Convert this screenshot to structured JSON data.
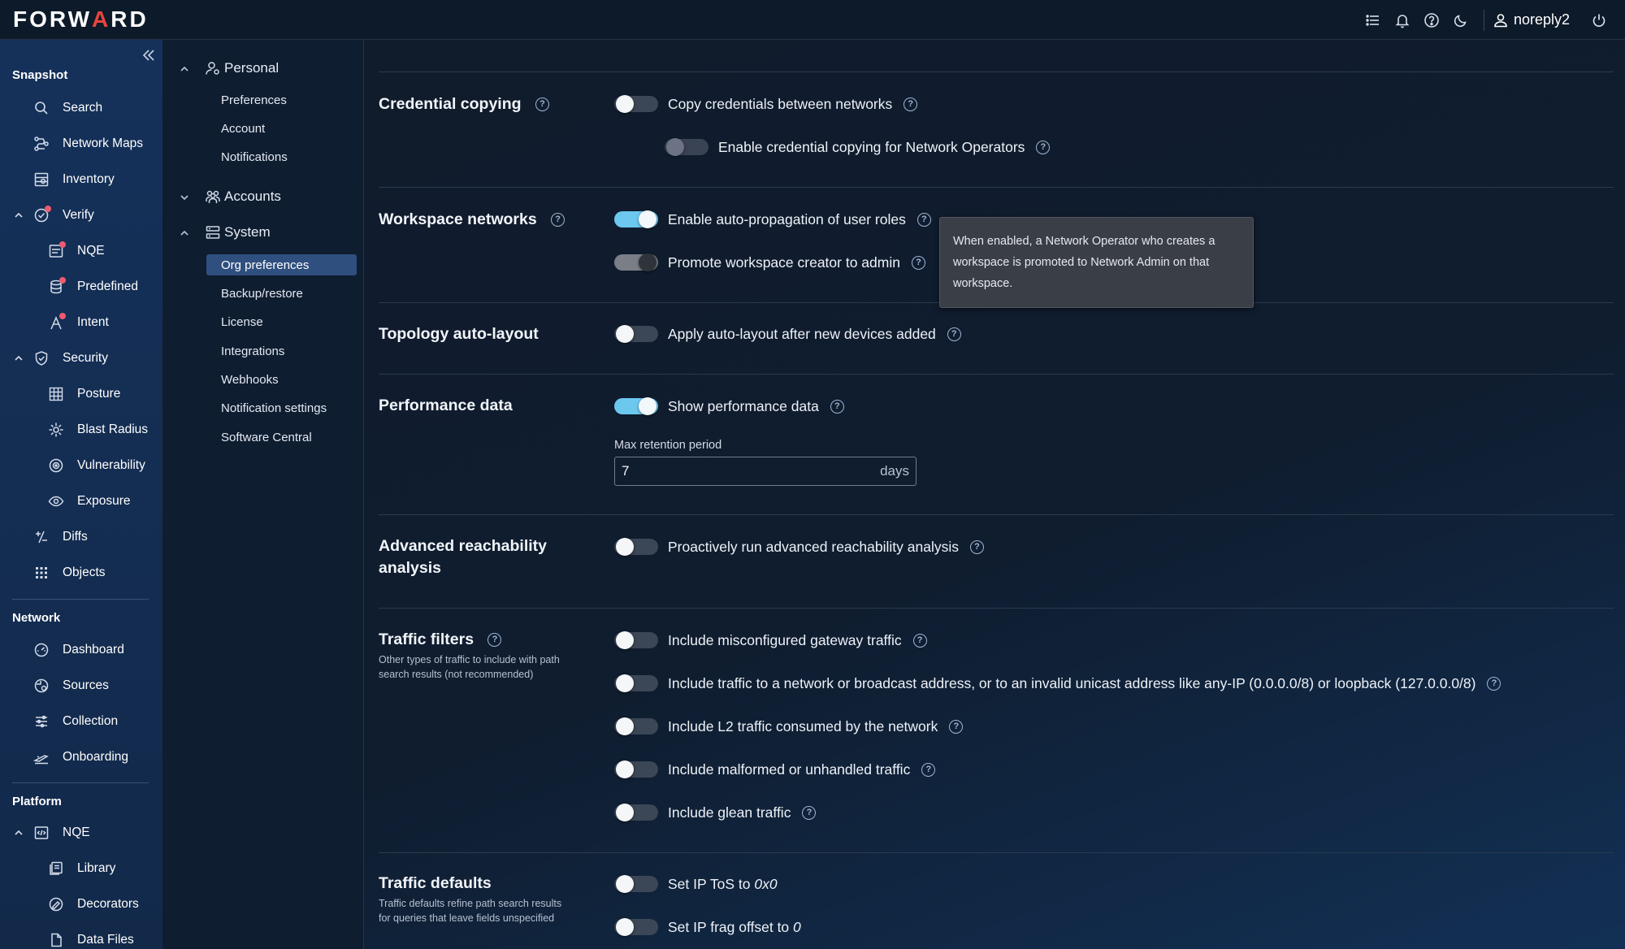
{
  "brand": {
    "logo_left": "FORW",
    "logo_accent": "A",
    "logo_right": "RD"
  },
  "topbar": {
    "username": "noreply2"
  },
  "leftnav": {
    "sections": {
      "snapshot": "Snapshot",
      "network": "Network",
      "platform": "Platform"
    },
    "items": {
      "search": "Search",
      "network_maps": "Network Maps",
      "inventory": "Inventory",
      "verify": "Verify",
      "nqe": "NQE",
      "predefined": "Predefined",
      "intent": "Intent",
      "security": "Security",
      "posture": "Posture",
      "blast_radius": "Blast Radius",
      "vulnerability": "Vulnerability",
      "exposure": "Exposure",
      "diffs": "Diffs",
      "objects": "Objects",
      "dashboard": "Dashboard",
      "sources": "Sources",
      "collection": "Collection",
      "onboarding": "Onboarding",
      "platform_nqe": "NQE",
      "library": "Library",
      "decorators": "Decorators",
      "data_files": "Data Files"
    }
  },
  "subnav": {
    "personal": "Personal",
    "preferences": "Preferences",
    "account": "Account",
    "notifications": "Notifications",
    "accounts": "Accounts",
    "system": "System",
    "org_preferences": "Org preferences",
    "backup_restore": "Backup/restore",
    "license": "License",
    "integrations": "Integrations",
    "webhooks": "Webhooks",
    "notification_settings": "Notification settings",
    "software_central": "Software Central"
  },
  "settings": {
    "credential_copying": {
      "title": "Credential copying",
      "copy_between": "Copy credentials between networks",
      "copy_operators": "Enable credential copying for Network Operators"
    },
    "workspace_networks": {
      "title": "Workspace networks",
      "auto_propagation": "Enable auto-propagation of user roles",
      "promote_creator": "Promote workspace creator to admin"
    },
    "tooltip": "When enabled, a Network Operator who creates a workspace is promoted to Network Admin on that workspace.",
    "topology": {
      "title": "Topology auto-layout",
      "apply": "Apply auto-layout after new devices added"
    },
    "performance": {
      "title": "Performance data",
      "show": "Show performance data",
      "retention_label": "Max retention period",
      "retention_value": "7",
      "retention_unit": "days"
    },
    "advanced": {
      "title_line1": "Advanced reachability",
      "title_line2": "analysis",
      "proactive": "Proactively run advanced reachability analysis"
    },
    "traffic_filters": {
      "title": "Traffic filters",
      "desc_line1": "Other types of traffic to include with path",
      "desc_line2": "search results (not recommended)",
      "misconfigured": "Include misconfigured gateway traffic",
      "broadcast": "Include traffic to a network or broadcast address, or to an invalid unicast address like any-IP (0.0.0.0/8) or loopback (127.0.0.0/8)",
      "l2": "Include L2 traffic consumed by the network",
      "malformed": "Include malformed or unhandled traffic",
      "glean": "Include glean traffic"
    },
    "traffic_defaults": {
      "title": "Traffic defaults",
      "desc_line1": "Traffic defaults refine path search results",
      "desc_line2": "for queries that leave fields unspecified",
      "tos_prefix": "Set IP ToS to ",
      "tos_value": "0x0",
      "frag_prefix": "Set IP frag offset to ",
      "frag_value": "0"
    }
  },
  "toggles": {
    "copy_between": false,
    "copy_operators": false,
    "auto_propagation": true,
    "promote_creator": true,
    "topology": false,
    "performance": true,
    "proactive": false,
    "misconfigured": false,
    "broadcast": false,
    "l2": false,
    "malformed": false,
    "glean": false,
    "tos": false,
    "frag": false
  }
}
